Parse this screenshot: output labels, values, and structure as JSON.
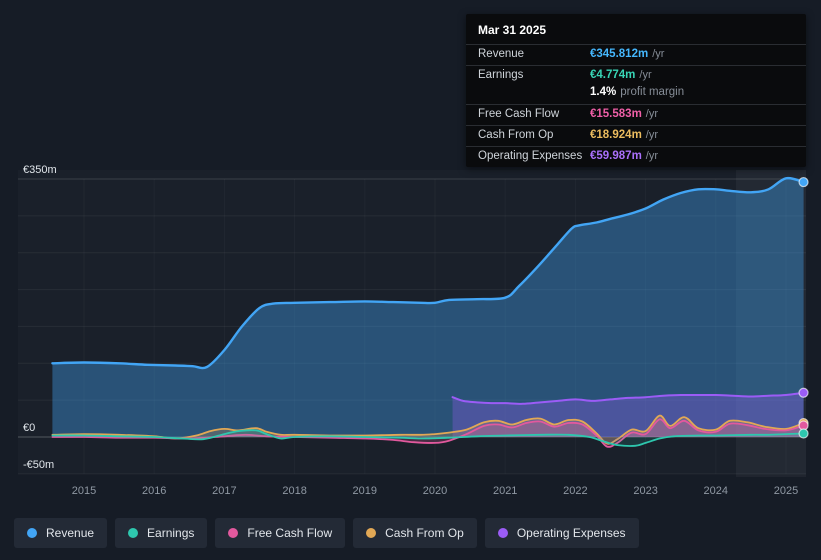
{
  "tooltip": {
    "date": "Mar 31 2025",
    "rows": [
      {
        "label": "Revenue",
        "value": "€345.812m",
        "suffix": "/yr",
        "color": "#45b7fd"
      },
      {
        "label": "Earnings",
        "value": "€4.774m",
        "suffix": "/yr",
        "color": "#38d5b6"
      },
      {
        "label": "Free Cash Flow",
        "value": "€15.583m",
        "suffix": "/yr",
        "color": "#ef5fa7"
      },
      {
        "label": "Cash From Op",
        "value": "€18.924m",
        "suffix": "/yr",
        "color": "#ecbc5f"
      },
      {
        "label": "Operating Expenses",
        "value": "€59.987m",
        "suffix": "/yr",
        "color": "#aa70fa"
      }
    ],
    "profit_margin": {
      "value": "1.4%",
      "label": "profit margin"
    }
  },
  "legend": [
    {
      "label": "Revenue",
      "color": "#42a5f5"
    },
    {
      "label": "Earnings",
      "color": "#2ec7ae"
    },
    {
      "label": "Free Cash Flow",
      "color": "#e2599e"
    },
    {
      "label": "Cash From Op",
      "color": "#e2a855"
    },
    {
      "label": "Operating Expenses",
      "color": "#9b5cf6"
    }
  ],
  "chart_data": {
    "type": "area",
    "title": "",
    "unit": "€m",
    "grid": true,
    "legend_position": "bottom",
    "x_axis": {
      "min": 2014.55,
      "max": 2025.3,
      "ticks": [
        2015,
        2016,
        2017,
        2018,
        2019,
        2020,
        2021,
        2022,
        2023,
        2024,
        2025
      ]
    },
    "y_axis": {
      "min": -50,
      "max": 350,
      "grid_step": 50,
      "labels": [
        {
          "value": 350,
          "text": "€350m"
        },
        {
          "value": 0,
          "text": "€0"
        },
        {
          "value": -50,
          "text": "-€50m"
        }
      ]
    },
    "series": [
      {
        "name": "Revenue",
        "color": "#42a5f5",
        "fill_opacity": 0.38,
        "line_width": 2.4,
        "points": [
          [
            2014.55,
            100
          ],
          [
            2015,
            101
          ],
          [
            2015.5,
            100
          ],
          [
            2015.9,
            98
          ],
          [
            2016.3,
            97
          ],
          [
            2016.55,
            96
          ],
          [
            2016.75,
            95
          ],
          [
            2017,
            118
          ],
          [
            2017.25,
            150
          ],
          [
            2017.5,
            175
          ],
          [
            2017.7,
            181
          ],
          [
            2018,
            182
          ],
          [
            2018.5,
            183
          ],
          [
            2019,
            184
          ],
          [
            2019.4,
            183
          ],
          [
            2019.8,
            182
          ],
          [
            2020,
            182
          ],
          [
            2020.2,
            186
          ],
          [
            2020.6,
            187
          ],
          [
            2021,
            189
          ],
          [
            2021.2,
            205
          ],
          [
            2021.5,
            235
          ],
          [
            2021.75,
            262
          ],
          [
            2021.95,
            283
          ],
          [
            2022.05,
            287
          ],
          [
            2022.3,
            291
          ],
          [
            2022.5,
            296
          ],
          [
            2022.75,
            302
          ],
          [
            2023,
            310
          ],
          [
            2023.25,
            322
          ],
          [
            2023.5,
            331
          ],
          [
            2023.75,
            336
          ],
          [
            2024,
            336
          ],
          [
            2024.2,
            334
          ],
          [
            2024.5,
            332
          ],
          [
            2024.75,
            336
          ],
          [
            2025,
            351
          ],
          [
            2025.25,
            345.812
          ]
        ]
      },
      {
        "name": "Earnings",
        "color": "#2ec7ae",
        "fill_opacity": 0.14,
        "line_width": 1.8,
        "points": [
          [
            2014.55,
            2
          ],
          [
            2015,
            2
          ],
          [
            2015.5,
            1
          ],
          [
            2016,
            0
          ],
          [
            2016.4,
            -2
          ],
          [
            2016.7,
            -3
          ],
          [
            2017,
            4
          ],
          [
            2017.2,
            8
          ],
          [
            2017.45,
            9
          ],
          [
            2017.6,
            4
          ],
          [
            2017.8,
            -2
          ],
          [
            2018,
            0
          ],
          [
            2018.5,
            1
          ],
          [
            2019,
            0
          ],
          [
            2019.5,
            -1
          ],
          [
            2019.8,
            -2
          ],
          [
            2020.2,
            -1
          ],
          [
            2020.6,
            1
          ],
          [
            2021,
            2
          ],
          [
            2021.5,
            3
          ],
          [
            2021.9,
            3
          ],
          [
            2022.2,
            0
          ],
          [
            2022.4,
            -6
          ],
          [
            2022.6,
            -11
          ],
          [
            2022.85,
            -12
          ],
          [
            2023,
            -8
          ],
          [
            2023.2,
            -2
          ],
          [
            2023.4,
            1
          ],
          [
            2023.75,
            2
          ],
          [
            2024,
            2
          ],
          [
            2024.5,
            3
          ],
          [
            2024.75,
            3
          ],
          [
            2025,
            4
          ],
          [
            2025.25,
            4.774
          ]
        ]
      },
      {
        "name": "Free Cash Flow",
        "color": "#e2599e",
        "fill_opacity": 0.22,
        "line_width": 1.8,
        "points": [
          [
            2014.55,
            0
          ],
          [
            2015,
            0
          ],
          [
            2015.5,
            -1
          ],
          [
            2016,
            -1
          ],
          [
            2016.5,
            -2
          ],
          [
            2017,
            1
          ],
          [
            2017.3,
            3
          ],
          [
            2017.6,
            1
          ],
          [
            2018,
            0
          ],
          [
            2018.5,
            -1
          ],
          [
            2019,
            -2
          ],
          [
            2019.4,
            -4
          ],
          [
            2019.7,
            -7
          ],
          [
            2020,
            -8
          ],
          [
            2020.2,
            -5
          ],
          [
            2020.45,
            4
          ],
          [
            2020.7,
            15
          ],
          [
            2020.9,
            17
          ],
          [
            2021.1,
            13
          ],
          [
            2021.3,
            19
          ],
          [
            2021.5,
            21
          ],
          [
            2021.7,
            14
          ],
          [
            2021.9,
            19
          ],
          [
            2022.1,
            17
          ],
          [
            2022.3,
            2
          ],
          [
            2022.45,
            -13
          ],
          [
            2022.6,
            -8
          ],
          [
            2022.8,
            6
          ],
          [
            2023,
            4
          ],
          [
            2023.2,
            24
          ],
          [
            2023.35,
            12
          ],
          [
            2023.55,
            22
          ],
          [
            2023.75,
            9
          ],
          [
            2024,
            7
          ],
          [
            2024.2,
            18
          ],
          [
            2024.45,
            16
          ],
          [
            2024.7,
            11
          ],
          [
            2025,
            9
          ],
          [
            2025.25,
            15.583
          ]
        ]
      },
      {
        "name": "Cash From Op",
        "color": "#e2a855",
        "fill_opacity": 0.22,
        "line_width": 1.8,
        "points": [
          [
            2014.55,
            3
          ],
          [
            2015,
            4
          ],
          [
            2015.5,
            3
          ],
          [
            2016,
            1
          ],
          [
            2016.3,
            -2
          ],
          [
            2016.6,
            2
          ],
          [
            2016.8,
            8
          ],
          [
            2017,
            11
          ],
          [
            2017.2,
            9
          ],
          [
            2017.45,
            12
          ],
          [
            2017.6,
            7
          ],
          [
            2017.8,
            3
          ],
          [
            2018,
            3
          ],
          [
            2018.5,
            2
          ],
          [
            2019,
            2
          ],
          [
            2019.5,
            3
          ],
          [
            2019.8,
            3
          ],
          [
            2020,
            4
          ],
          [
            2020.2,
            6
          ],
          [
            2020.45,
            10
          ],
          [
            2020.7,
            20
          ],
          [
            2020.9,
            22
          ],
          [
            2021.1,
            17
          ],
          [
            2021.3,
            23
          ],
          [
            2021.5,
            25
          ],
          [
            2021.7,
            17
          ],
          [
            2021.9,
            23
          ],
          [
            2022.1,
            21
          ],
          [
            2022.3,
            5
          ],
          [
            2022.45,
            -9
          ],
          [
            2022.6,
            -3
          ],
          [
            2022.8,
            10
          ],
          [
            2023,
            8
          ],
          [
            2023.2,
            29
          ],
          [
            2023.35,
            15
          ],
          [
            2023.55,
            27
          ],
          [
            2023.75,
            12
          ],
          [
            2024,
            10
          ],
          [
            2024.2,
            22
          ],
          [
            2024.45,
            20
          ],
          [
            2024.7,
            14
          ],
          [
            2025,
            11
          ],
          [
            2025.25,
            18.924
          ]
        ]
      },
      {
        "name": "Operating Expenses",
        "color": "#9b5cf6",
        "fill_opacity": 0.3,
        "line_width": 2,
        "points": [
          [
            2020.25,
            54
          ],
          [
            2020.4,
            49
          ],
          [
            2020.6,
            47
          ],
          [
            2020.8,
            46
          ],
          [
            2021,
            46
          ],
          [
            2021.25,
            45
          ],
          [
            2021.5,
            47
          ],
          [
            2021.75,
            49
          ],
          [
            2022,
            51
          ],
          [
            2022.25,
            49
          ],
          [
            2022.5,
            51
          ],
          [
            2022.75,
            53
          ],
          [
            2023,
            54
          ],
          [
            2023.25,
            56
          ],
          [
            2023.5,
            57
          ],
          [
            2023.75,
            57
          ],
          [
            2024,
            57
          ],
          [
            2024.25,
            56
          ],
          [
            2024.5,
            55
          ],
          [
            2024.75,
            56
          ],
          [
            2025,
            57
          ],
          [
            2025.25,
            59.987
          ]
        ]
      }
    ]
  }
}
